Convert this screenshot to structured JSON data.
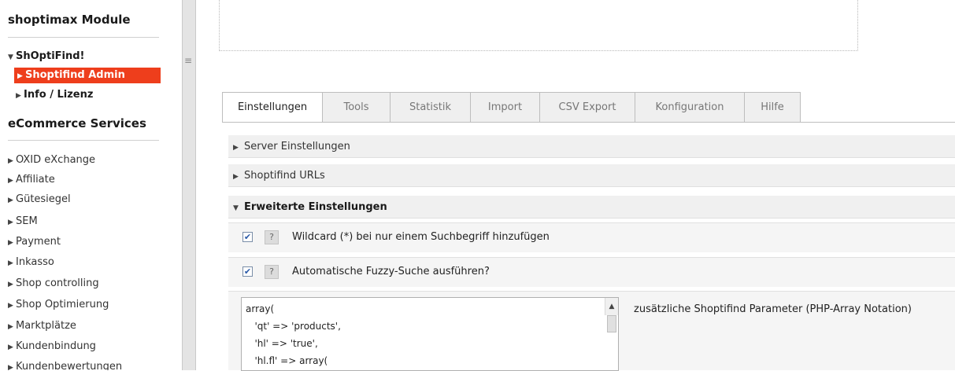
{
  "sidebar": {
    "section1_title": "shoptimax Module",
    "group1": "ShOptiFind!",
    "active_item": "Shoptifind Admin",
    "info_item": "Info / Lizenz",
    "section2_title": "eCommerce Services",
    "items": [
      "OXID eXchange",
      "Affiliate",
      "Gütesiegel",
      "SEM",
      "Payment",
      "Inkasso",
      "Shop controlling",
      "Shop Optimierung",
      "Marktplätze",
      "Kundenbindung",
      "Kundenbewertungen"
    ],
    "splitter_grip": "≡"
  },
  "tabs": [
    "Einstellungen",
    "Tools",
    "Statistik",
    "Import",
    "CSV Export",
    "Konfiguration",
    "Hilfe"
  ],
  "sections": {
    "server": "Server Einstellungen",
    "urls": "Shoptifind URLs",
    "extended": "Erweiterte Einstellungen"
  },
  "options": [
    {
      "label": "Wildcard (*) bei nur einem Suchbegriff hinzufügen",
      "checked": true,
      "help": "?"
    },
    {
      "label": "Automatische Fuzzy-Suche ausführen?",
      "checked": true,
      "help": "?"
    }
  ],
  "params": {
    "lines": [
      "array(",
      "   'qt' => 'products',",
      "   'hl' => 'true',",
      "   'hl.fl' => array("
    ],
    "label": "zusätzliche Shoptifind Parameter (PHP-Array Notation)"
  },
  "icons": {
    "collapsed": "triangle-right-icon",
    "expanded": "triangle-down-icon",
    "check": "✔"
  },
  "colors": {
    "active_bg": "#ee3e1c",
    "section_bg": "#f0f0f0"
  }
}
